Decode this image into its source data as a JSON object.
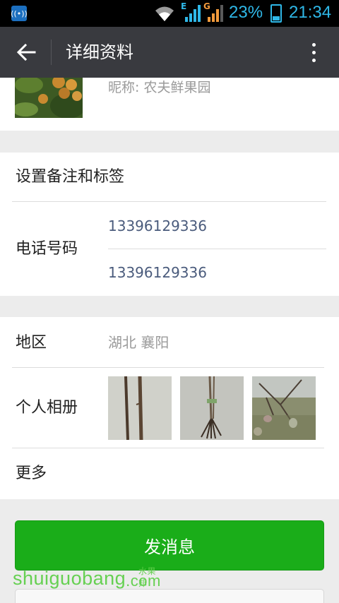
{
  "status_bar": {
    "battery_percent": "23%",
    "time": "21:34",
    "network_tags": [
      "E",
      "G"
    ]
  },
  "toolbar": {
    "title": "详细资料"
  },
  "profile": {
    "nickname": "昵称: 农夫鲜果园"
  },
  "remark_row": {
    "label": "设置备注和标签"
  },
  "phone_row": {
    "label": "电话号码",
    "numbers": [
      "13396129336",
      "13396129336"
    ]
  },
  "region_row": {
    "label": "地区",
    "value": "湖北  襄阳"
  },
  "album_row": {
    "label": "个人相册"
  },
  "more_row": {
    "label": "更多"
  },
  "actions": {
    "send_label": "发消息"
  },
  "watermark": {
    "text": "shuiguobang",
    "suffix": ".com",
    "cn": "水果邦"
  },
  "colors": {
    "toolbar": "#393a3f",
    "send_button": "#1aad19",
    "phone_link": "#4a5b7c",
    "status_accent": "#2fb8e8"
  }
}
